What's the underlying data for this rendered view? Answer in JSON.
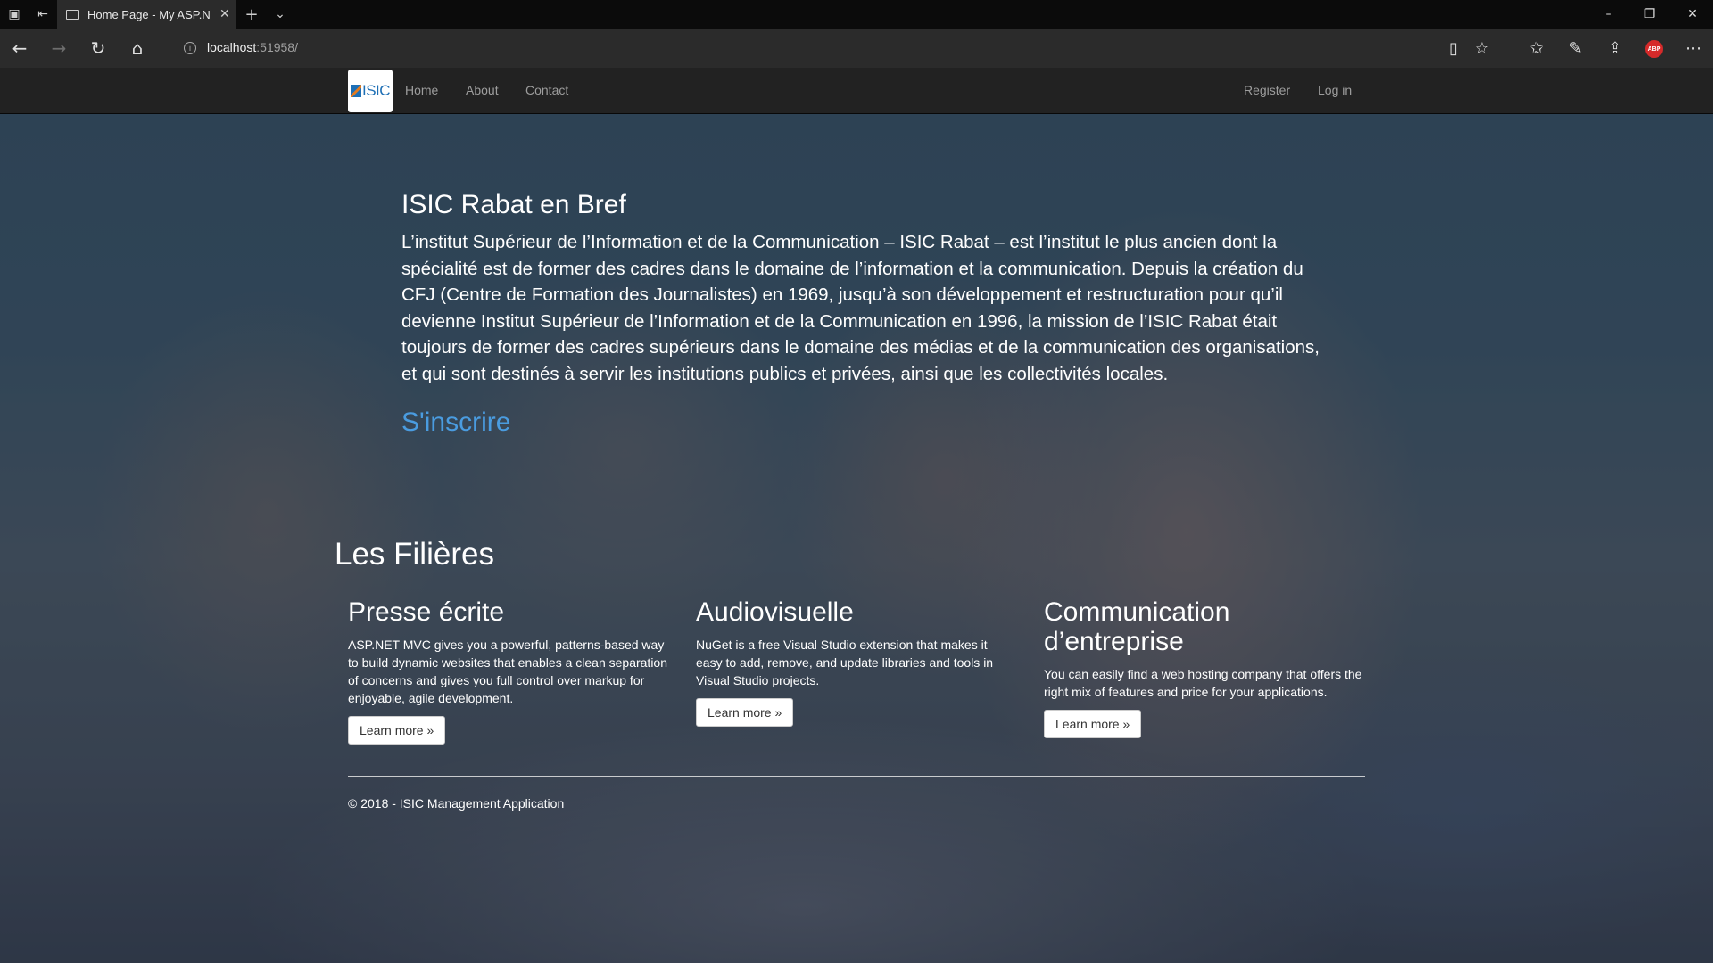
{
  "browser": {
    "tab_title": "Home Page - My ASP.N",
    "url_host": "localhost",
    "url_rest": ":51958/",
    "abp_label": "ABP"
  },
  "navbar": {
    "logo_text": "ISIC",
    "links": [
      "Home",
      "About",
      "Contact"
    ],
    "right_links": [
      "Register",
      "Log in"
    ]
  },
  "jumbotron": {
    "title": "ISIC Rabat en Bref",
    "text": "L’institut Supérieur de l’Information et de la Communication – ISIC Rabat – est l’institut le plus ancien dont la spécialité est de former des cadres dans le domaine de l’information et la communication. Depuis la création du CFJ (Centre de Formation des Journalistes) en 1969, jusqu’à son développement et restructuration pour qu’il devienne Institut Supérieur de l’Information et de la Communication en 1996, la mission de l’ISIC Rabat était toujours de former des cadres supérieurs dans le domaine des médias et de la communication des organisations, et qui sont destinés à servir les institutions publics et privées, ainsi que les collectivités locales.",
    "cta": "S'inscrire"
  },
  "filieres": {
    "title": "Les Filières",
    "items": [
      {
        "title": "Presse écrite",
        "text": "ASP.NET MVC gives you a powerful, patterns-based way to build dynamic websites that enables a clean separation of concerns and gives you full control over markup for enjoyable, agile development.",
        "button": "Learn more »"
      },
      {
        "title": "Audiovisuelle",
        "text": "NuGet is a free Visual Studio extension that makes it easy to add, remove, and update libraries and tools in Visual Studio projects.",
        "button": "Learn more »"
      },
      {
        "title": "Communication d’entreprise",
        "text": "You can easily find a web hosting company that offers the right mix of features and price for your applications.",
        "button": "Learn more »"
      }
    ]
  },
  "footer": {
    "text": "© 2018 - ISIC Management Application"
  },
  "colors": {
    "navbar_bg": "#222222",
    "nav_link": "#9d9d9d",
    "cta": "#4a9ce0",
    "logo_blue": "#1e6fb5"
  }
}
